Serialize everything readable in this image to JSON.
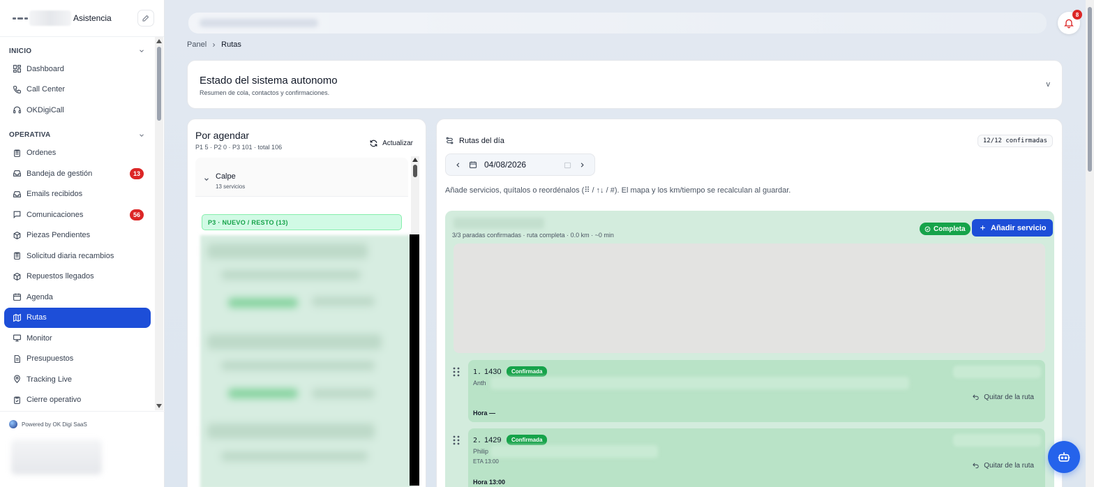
{
  "sidebar": {
    "brand_name": "Asistencia",
    "sections": [
      {
        "title": "INICIO",
        "items": [
          {
            "label": "Dashboard",
            "icon": "dashboard-icon"
          },
          {
            "label": "Call Center",
            "icon": "phone-icon"
          },
          {
            "label": "OKDigiCall",
            "icon": "headset-icon"
          }
        ]
      },
      {
        "title": "OPERATIVA",
        "items": [
          {
            "label": "Ordenes",
            "icon": "clipboard-icon"
          },
          {
            "label": "Bandeja de gestión",
            "icon": "inbox-icon",
            "badge": "13"
          },
          {
            "label": "Emails recibidos",
            "icon": "inbox-icon"
          },
          {
            "label": "Comunicaciones",
            "icon": "chat-icon",
            "badge": "56"
          },
          {
            "label": "Piezas Pendientes",
            "icon": "package-icon"
          },
          {
            "label": "Solicitud diaria recambios",
            "icon": "clipboard-icon"
          },
          {
            "label": "Repuestos llegados",
            "icon": "package-icon"
          },
          {
            "label": "Agenda",
            "icon": "calendar-icon"
          },
          {
            "label": "Rutas",
            "icon": "map-icon",
            "active": true
          },
          {
            "label": "Monitor",
            "icon": "monitor-icon"
          },
          {
            "label": "Presupuestos",
            "icon": "document-icon"
          },
          {
            "label": "Tracking Live",
            "icon": "location-pin-icon"
          },
          {
            "label": "Cierre operativo",
            "icon": "clipboard-check-icon"
          }
        ]
      }
    ],
    "powered_by": "Powered by OK Digi SaaS"
  },
  "header": {
    "notifications_count": "8"
  },
  "breadcrumb": {
    "root": "Panel",
    "current": "Rutas"
  },
  "status_panel": {
    "title": "Estado del sistema autonomo",
    "subtitle": "Resumen de cola, contactos y confirmaciones.",
    "toggle": "v"
  },
  "schedule_panel": {
    "title": "Por agendar",
    "summary": "P1 5 · P2 0 · P3 101 · total 106",
    "refresh_label": "Actualizar",
    "group": {
      "name": "Calpe",
      "count": "13 servicios"
    },
    "priority_header": "P3 · NUEVO / RESTO (13)"
  },
  "routes_panel": {
    "title": "Rutas del día",
    "confirmed": "12/12 confirmadas",
    "date": "04/08/2026",
    "note": "Añade servicios, quítalos o reordénalos (⠿ / ↑↓ / #). El mapa y los km/tiempo se recalculan al guardar.",
    "route": {
      "summary": "3/3 paradas confirmadas · ruta completa · 0.0 km · ~0 min",
      "status": "Completa",
      "add_label": "Añadir servicio"
    },
    "stops": [
      {
        "index": "1.",
        "code": "1430",
        "status": "Confirmada",
        "name": "Anth",
        "eta": "",
        "time": "Hora —",
        "remove_label": "Quitar de la ruta"
      },
      {
        "index": "2.",
        "code": "1429",
        "status": "Confirmada",
        "name": "Philip",
        "eta": "ETA 13:00",
        "time": "Hora 13:00",
        "remove_label": "Quitar de la ruta"
      }
    ]
  },
  "colors": {
    "primary": "#1d4ed8",
    "success": "#16a34a",
    "danger": "#dc2626",
    "route_bg": "#d3ecdd",
    "stop_bg": "#b9e3c7"
  }
}
